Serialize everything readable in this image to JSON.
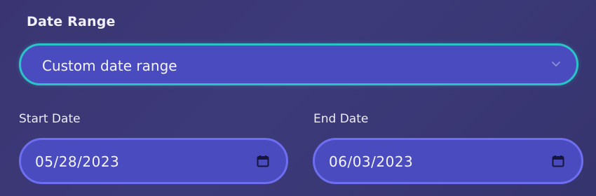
{
  "date_range": {
    "label": "Date Range",
    "selected": "Custom date range",
    "icon": "chevron-down-icon"
  },
  "start_date": {
    "label": "Start Date",
    "value": "05/28/2023",
    "icon": "calendar-icon"
  },
  "end_date": {
    "label": "End Date",
    "value": "06/03/2023",
    "icon": "calendar-icon"
  },
  "colors": {
    "background": "#3a3572",
    "field_fill": "#4a4bbf",
    "select_border": "#2cc3c8",
    "input_border": "#6d6ef0"
  }
}
